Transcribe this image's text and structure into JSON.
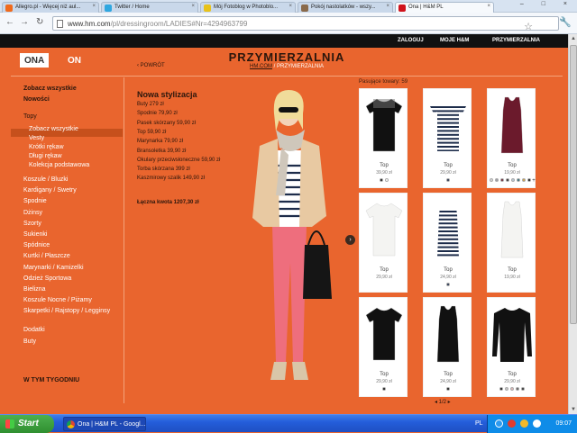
{
  "browser": {
    "tabs": [
      {
        "title": "Allegro.pl - Więcej niż aul...",
        "favicon_color": "#f06a1c",
        "active": false
      },
      {
        "title": "Twitter / Home",
        "favicon_color": "#2fa7e0",
        "active": false
      },
      {
        "title": "Mój Fotoblog w Photoblo...",
        "favicon_color": "#e8c21a",
        "active": false
      },
      {
        "title": "Pokój nastolatków - wszy...",
        "favicon_color": "#8a6a4a",
        "active": false
      },
      {
        "title": "Ona | H&M PL",
        "favicon_color": "#d0121b",
        "active": true
      }
    ],
    "url_host": "www.hm.com",
    "url_path": "/pl/dressingroom/LADIES#Nr=4294963799",
    "window_controls": "– □ ×"
  },
  "hm_topbar": {
    "login": "ZALOGUJ",
    "my_hm": "MOJE H&M",
    "fitting_room": "PRZYMIERZALNIA"
  },
  "header": {
    "gender_women": "ONA",
    "gender_men": "ON",
    "title": "PRZYMIERZALNIA",
    "breadcrumb_home": "HM.COM",
    "breadcrumb_sep": " / ",
    "breadcrumb_current": "PRZYMIERZALNIA",
    "back": "‹ POWRÓT"
  },
  "sidebar": {
    "see_all": "Zobacz wszystkie",
    "new": "Nowości",
    "tops": "Topy",
    "tops_sub": [
      "Zobacz wszystkie",
      "Vesty",
      "Krótki rękaw",
      "Długi rękaw",
      "Kolekcja podstawowa"
    ],
    "categories": [
      "Koszule / Bluzki",
      "Kardigany / Swetry",
      "Spodnie",
      "Dżinsy",
      "Szorty",
      "Sukienki",
      "Spódnice",
      "Kurtki / Płaszcze",
      "Marynarki / Kamizelki",
      "Odzież Sportowa",
      "Bielizna",
      "Koszule Nocne / Piżamy",
      "Skarpetki / Rajstopy / Legginsy",
      "Dodatki",
      "Buty"
    ],
    "this_week": "W TYM TYGODNIU"
  },
  "look": {
    "title": "Nowa stylizacja",
    "items": [
      "Buty 279 zł",
      "Spodnie 79,90 zł",
      "Pasek skórzany 59,90 zł",
      "Top 59,90 zł",
      "Marynarka 79,90 zł",
      "Bransoletka 39,90 zł",
      "Okulary przeciwsłoneczne 59,90 zł",
      "Torba skórzana 399 zł",
      "Kaszmirowy szalik 149,90 zł"
    ],
    "total": "Łączna kwota 1207,30 zł"
  },
  "products": {
    "matching": "Pasujące towary: 59",
    "items": [
      {
        "type": "Top",
        "price": "39,90 zł",
        "kind": "lace-black",
        "swatches": [
          "#111111",
          "#ffffff"
        ]
      },
      {
        "type": "Top",
        "price": "29,90 zł",
        "kind": "stripe-tee",
        "swatches": [
          "#1d2c4a"
        ]
      },
      {
        "type": "Top",
        "price": "19,90 zł",
        "kind": "tank-wine",
        "swatches": [
          "#d8d8d8",
          "#9a9aa4",
          "#6b1a2c",
          "#2b2b2b",
          "#b9c9d6",
          "#2a6d7a",
          "#d4a13a",
          "#111111"
        ],
        "more": "+"
      },
      {
        "type": "Top",
        "price": "29,90 zł",
        "kind": "white-tee",
        "swatches": []
      },
      {
        "type": "Top",
        "price": "24,90 zł",
        "kind": "stripe-tank",
        "swatches": [
          "#1d2c4a"
        ]
      },
      {
        "type": "Top",
        "price": "19,90 zł",
        "kind": "white-tank",
        "swatches": []
      },
      {
        "type": "Top",
        "price": "29,90 zł",
        "kind": "black-tee",
        "swatches": [
          "#111111"
        ]
      },
      {
        "type": "Top",
        "price": "24,90 zł",
        "kind": "black-tank",
        "swatches": [
          "#111111"
        ]
      },
      {
        "type": "Top",
        "price": "29,90 zł",
        "kind": "black-long",
        "swatches": [
          "#111111",
          "#c9c9c9",
          "#e3b8b8",
          "#5a5a5a",
          "#2a2a2a"
        ]
      }
    ],
    "pager": "◂ 1/2 ▸"
  },
  "taskbar": {
    "start": "Start",
    "window": "Ona | H&M PL - Googl...",
    "lang": "PL",
    "time": "09:07"
  }
}
